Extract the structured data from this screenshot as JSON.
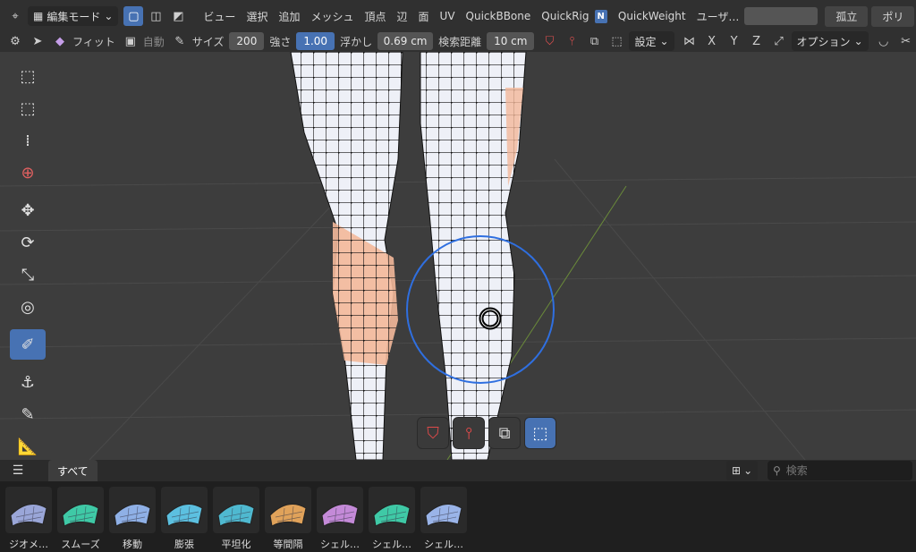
{
  "menubar": {
    "mode": "編集モード",
    "menus": [
      "ビュー",
      "選択",
      "追加",
      "メッシュ",
      "頂点",
      "辺",
      "面",
      "UV",
      "QuickBBone",
      "QuickRig"
    ],
    "addon_badge": "N",
    "addon_name": "QuickWeight",
    "user_label": "ユーザ…",
    "isolate": "孤立",
    "poly": "ポリ"
  },
  "toolbar": {
    "brush": "フィット",
    "auto": "自動",
    "size_label": "サイズ",
    "size_value": "200",
    "strength_label": "強さ",
    "strength_value": "1.00",
    "float_label": "浮かし",
    "float_value": "0.69 cm",
    "search_dist_label": "検索距離",
    "search_dist_value": "10 cm",
    "settings": "設定",
    "x": "X",
    "y": "Y",
    "z": "Z",
    "options": "オプション"
  },
  "asset_browser": {
    "tab_all": "すべて",
    "search_placeholder": "検索",
    "items": [
      {
        "label": "ジオメ…",
        "color": "#9aa6d8"
      },
      {
        "label": "スムーズ",
        "color": "#3fc9a6"
      },
      {
        "label": "移動",
        "color": "#8fb0e6"
      },
      {
        "label": "膨張",
        "color": "#5cc0e0"
      },
      {
        "label": "平坦化",
        "color": "#4fb9d0"
      },
      {
        "label": "等間隔",
        "color": "#e0a25a"
      },
      {
        "label": "シェル…",
        "color": "#c48ad8"
      },
      {
        "label": "シェル…",
        "color": "#3fc9a6"
      },
      {
        "label": "シェル…",
        "color": "#9ab4e8"
      }
    ]
  },
  "colors": {
    "accent": "#4772b3",
    "brush_circle": "#2f6fe0",
    "mesh_fill": "#e8ecf4",
    "weight_orange": "#f3b89a"
  }
}
